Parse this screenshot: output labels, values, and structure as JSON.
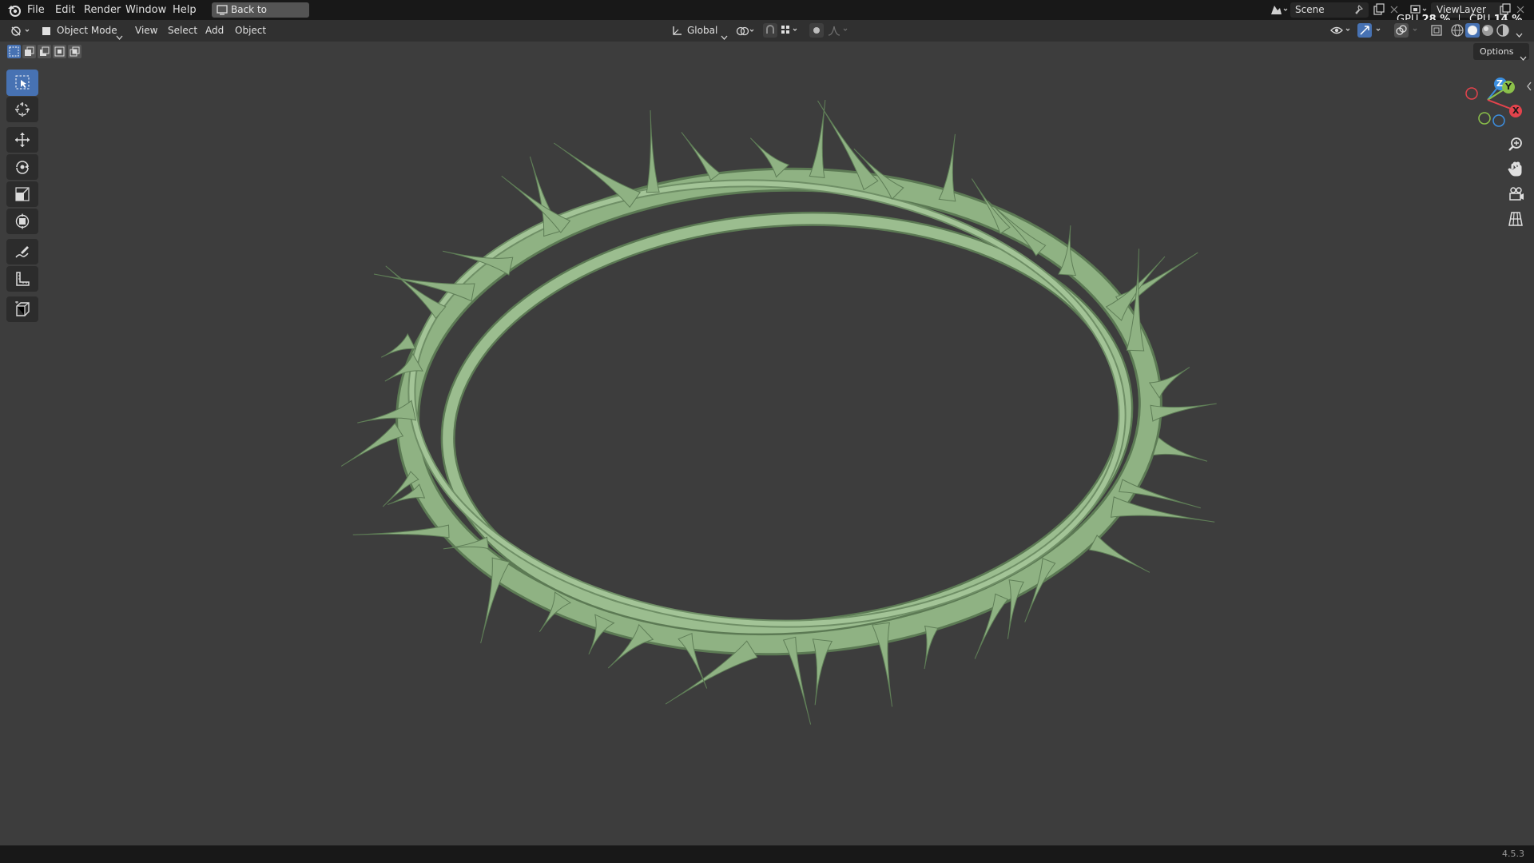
{
  "menu": {
    "file": "File",
    "edit": "Edit",
    "render": "Render",
    "window": "Window",
    "help": "Help",
    "back_to_previous": "Back to Previous"
  },
  "scene": {
    "name": "Scene"
  },
  "view_layer": {
    "name": "ViewLayer"
  },
  "stats": {
    "gpu_label": "GPU",
    "gpu_value": "28 %",
    "cpu_label": "CPU",
    "cpu_value": "14 %"
  },
  "header": {
    "mode": "Object Mode",
    "view": "View",
    "select": "Select",
    "add": "Add",
    "object": "Object",
    "transform_orientation": "Global",
    "options": "Options"
  },
  "gizmo": {
    "x": "X",
    "y": "Y",
    "z": "Z"
  },
  "tools": [
    "select-box",
    "cursor",
    "move",
    "rotate",
    "scale",
    "transform",
    "annotate",
    "measure",
    "add-cube"
  ],
  "icons": [
    "blender-logo-icon",
    "editor-type-icon",
    "object-mode-icon",
    "search-zoom-icon",
    "hand-pan-icon",
    "camera-icon",
    "grid-icon"
  ],
  "colors": {
    "accent": "#4772b3",
    "model": "#8fb283",
    "axis_x": "#e4434c",
    "axis_y": "#8bc04a",
    "axis_z": "#3c8fe0"
  },
  "status": {
    "version": "4.5.3"
  }
}
